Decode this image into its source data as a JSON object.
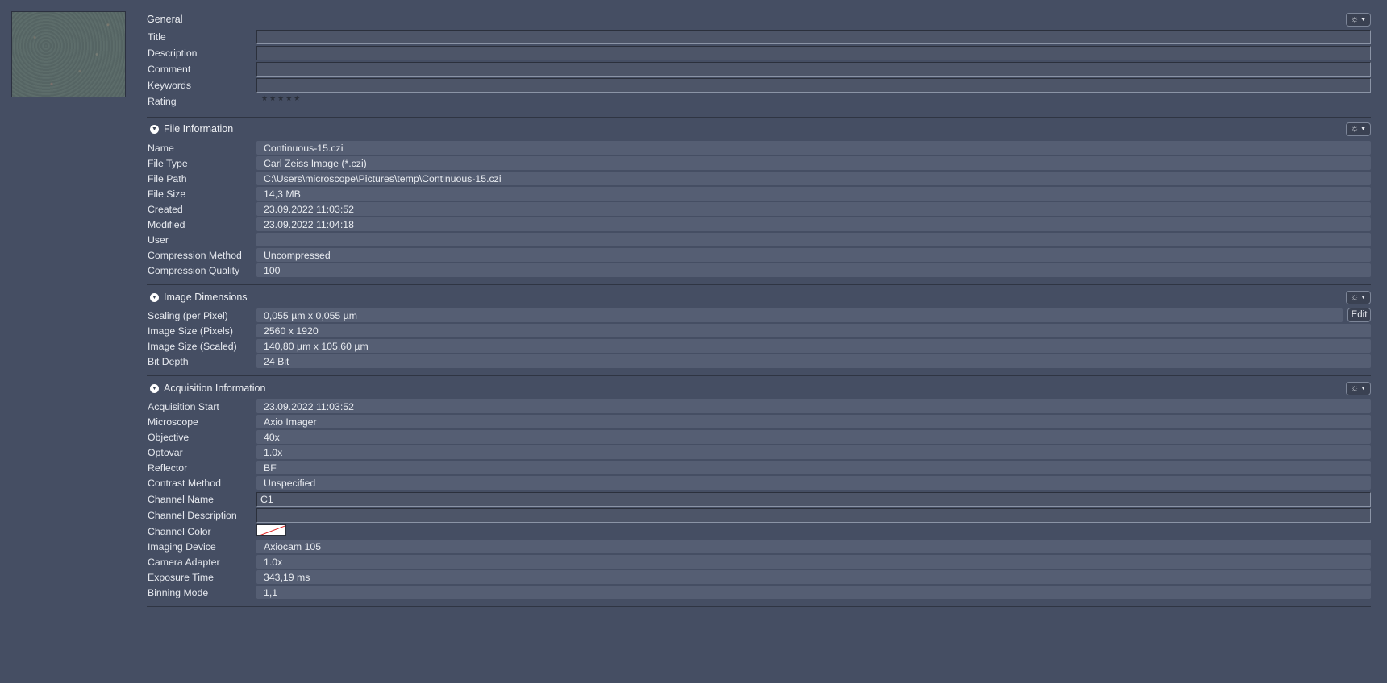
{
  "general": {
    "title": "General",
    "fields": [
      {
        "label": "Title",
        "value": ""
      },
      {
        "label": "Description",
        "value": ""
      },
      {
        "label": "Comment",
        "value": ""
      },
      {
        "label": "Keywords",
        "value": ""
      }
    ],
    "rating_label": "Rating",
    "rating_stars": "★★★★★",
    "rating_value": 0,
    "rating_max": 5
  },
  "file_information": {
    "title": "File Information",
    "rows": [
      {
        "label": "Name",
        "value": "Continuous-15.czi"
      },
      {
        "label": "File Type",
        "value": "Carl Zeiss Image (*.czi)"
      },
      {
        "label": "File Path",
        "value": "C:\\Users\\microscope\\Pictures\\temp\\Continuous-15.czi"
      },
      {
        "label": "File Size",
        "value": "14,3 MB"
      },
      {
        "label": "Created",
        "value": "23.09.2022 11:03:52"
      },
      {
        "label": "Modified",
        "value": "23.09.2022 11:04:18"
      },
      {
        "label": "User",
        "value": ""
      },
      {
        "label": "Compression Method",
        "value": "Uncompressed"
      },
      {
        "label": "Compression Quality",
        "value": "100"
      }
    ]
  },
  "image_dimensions": {
    "title": "Image Dimensions",
    "edit_label": "Edit",
    "rows": [
      {
        "label": "Scaling (per Pixel)",
        "value": "0,055 µm x 0,055 µm"
      },
      {
        "label": "Image Size (Pixels)",
        "value": "2560 x 1920"
      },
      {
        "label": "Image Size (Scaled)",
        "value": "140,80 µm x 105,60 µm"
      },
      {
        "label": "Bit Depth",
        "value": "24 Bit"
      }
    ]
  },
  "acquisition_information": {
    "title": "Acquisition Information",
    "rows_a": [
      {
        "label": "Acquisition Start",
        "value": "23.09.2022 11:03:52"
      },
      {
        "label": "Microscope",
        "value": "Axio Imager"
      },
      {
        "label": "Objective",
        "value": "40x"
      },
      {
        "label": "Optovar",
        "value": "1.0x"
      },
      {
        "label": "Reflector",
        "value": "BF"
      },
      {
        "label": "Contrast Method",
        "value": "Unspecified"
      }
    ],
    "channel_name_label": "Channel Name",
    "channel_name_value": "C1",
    "channel_description_label": "Channel Description",
    "channel_description_value": "",
    "channel_color_label": "Channel Color",
    "channel_color_value": "#ffffff",
    "rows_b": [
      {
        "label": "Imaging Device",
        "value": "Axiocam 105"
      },
      {
        "label": "Camera Adapter",
        "value": "1.0x"
      },
      {
        "label": "Exposure Time",
        "value": "343,19 ms"
      },
      {
        "label": "Binning Mode",
        "value": "1,1"
      }
    ]
  },
  "icons": {
    "gear": "gear-icon",
    "caret": "caret-down-icon",
    "collapse": "collapse-icon"
  },
  "colors": {
    "background": "#454e63",
    "value_field": "#555e73",
    "text": "#e6e9ef"
  }
}
